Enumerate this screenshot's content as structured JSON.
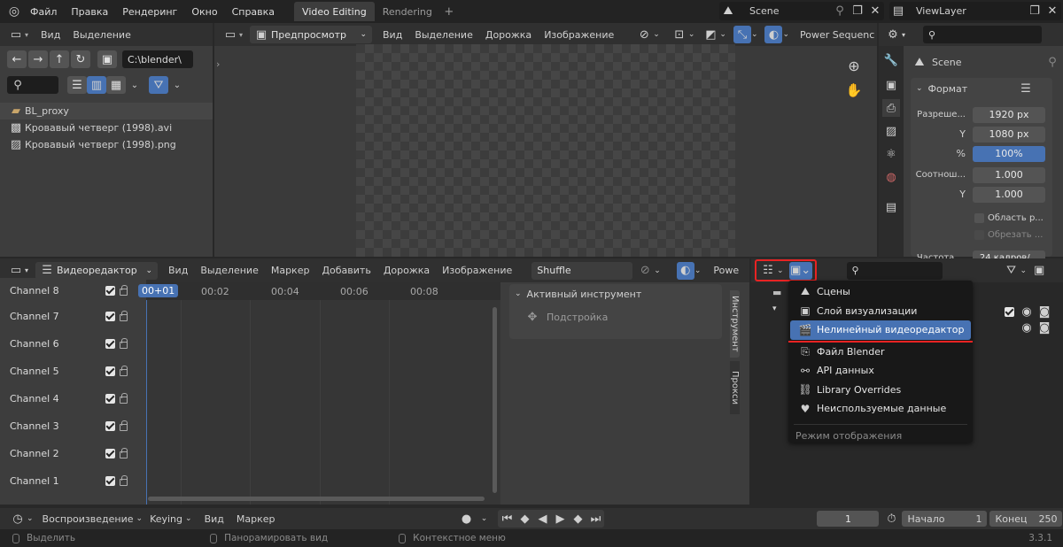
{
  "topbar": {
    "menus": [
      "Файл",
      "Правка",
      "Рендеринг",
      "Окно",
      "Справка"
    ],
    "workspace_tabs": [
      "Video Editing",
      "Rendering"
    ],
    "scene_name": "Scene",
    "view_layer": "ViewLayer"
  },
  "file_browser": {
    "menus": [
      "Вид",
      "Выделение"
    ],
    "path": "C:\\blender\\",
    "files": [
      "BL_proxy",
      "Кровавый четверг (1998).avi",
      "Кровавый четверг (1998).png"
    ]
  },
  "preview": {
    "mode": "Предпросмотр",
    "menus": [
      "Вид",
      "Выделение",
      "Дорожка",
      "Изображение"
    ],
    "power_label": "Power Sequenc"
  },
  "properties": {
    "scene_label": "Scene",
    "format_panel": "Формат",
    "res_x_label": "Разреше...",
    "res_x": "1920 px",
    "res_y_label": "Y",
    "res_y": "1080 px",
    "percent_label": "%",
    "percent": "100%",
    "aspect_label": "Соотнош...",
    "aspect_x": "1.000",
    "aspect_y_label": "Y",
    "aspect_y": "1.000",
    "region_label": "Область р...",
    "crop_label": "Обрезать ...",
    "fps_label": "Частота ...",
    "fps_value": "24 кадров/..."
  },
  "sequencer": {
    "editor_name": "Видеоредактор",
    "menus": [
      "Вид",
      "Выделение",
      "Маркер",
      "Добавить",
      "Дорожка",
      "Изображение"
    ],
    "overlay_label": "Shuffle",
    "power_label": "Powe",
    "frames": [
      "00+01",
      "00:02",
      "00:04",
      "00:06",
      "00:08"
    ],
    "channels": [
      "Channel 8",
      "Channel 7",
      "Channel 6",
      "Channel 5",
      "Channel 4",
      "Channel 3",
      "Channel 2",
      "Channel 1"
    ],
    "tool_panel_title": "Активный инструмент",
    "tool_name": "Подстройка",
    "side_tabs": [
      "Инструмент",
      "Прокси"
    ]
  },
  "outliner_dropdown": {
    "items": [
      "Сцены",
      "Слой визуализации",
      "Нелинейный видеоредактор",
      "Файл Blender",
      "API данных",
      "Library Overrides",
      "Неиспользуемые данные"
    ],
    "footer": "Режим отображения",
    "selected_index": 2,
    "highlight_color": "#e82323",
    "select_color": "#4772b3"
  },
  "timeline": {
    "menus": [
      "Воспроизведение",
      "Keying",
      "Вид",
      "Маркер"
    ],
    "current_frame": "1",
    "start_label": "Начало",
    "start": "1",
    "end_label": "Конец",
    "end": "250"
  },
  "statusbar": {
    "select": "Выделить",
    "pan": "Панорамировать вид",
    "context": "Контекстное меню",
    "version": "3.3.1"
  }
}
